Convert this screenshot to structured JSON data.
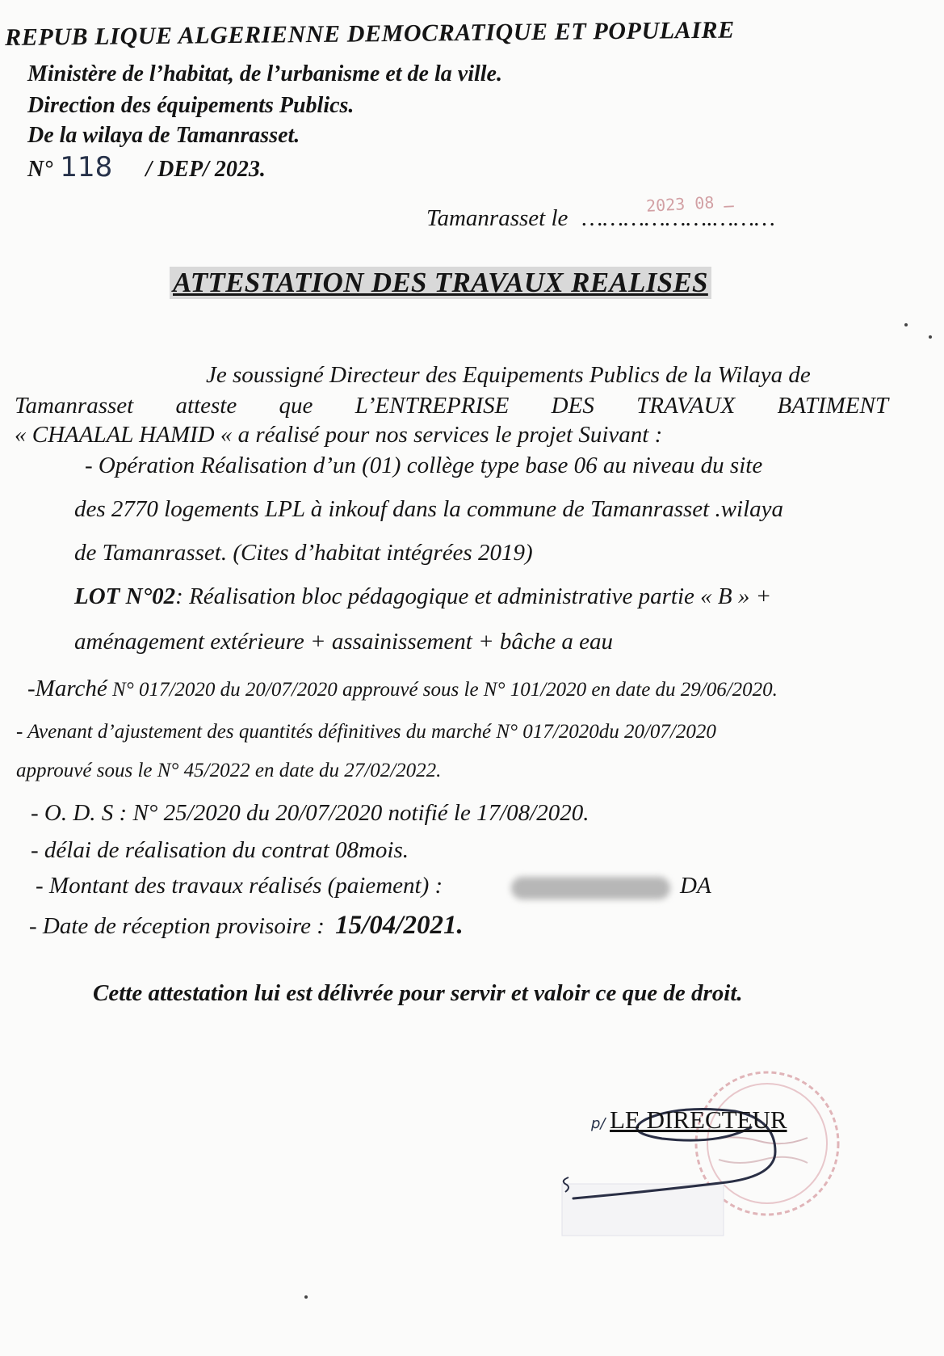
{
  "header": {
    "republic": "REPUB LIQUE  ALGERIENNE  DEMOCRATIQUE  ET  POPULAIRE",
    "ministry": "Ministère de l’habitat, de l’urbanisme et de la ville.",
    "direction": "Direction  des équipements Publics.",
    "wilaya": "De la wilaya de Tamanrasset.",
    "ref_prefix": "N°",
    "ref_number": "118",
    "ref_suffix": "/ DEP/ 2023."
  },
  "date_line": {
    "label": "Tamanrasset le",
    "dots": "……………….………",
    "stamp": "2023 ـ 08"
  },
  "title": "ATTESTATION DES TRAVAUX REALISES",
  "intro": {
    "line1": "Je soussigné Directeur  des Equipements Publics de la Wilaya de",
    "line2_words": [
      "Tamanrasset",
      "atteste",
      "que",
      "L’ENTREPRISE",
      "DES",
      "TRAVAUX",
      "BATIMENT"
    ],
    "line3": "« CHAALAL HAMID «    a réalisé pour nos services le projet Suivant :"
  },
  "operation": {
    "line1": "-   Opération Réalisation d’un (01) collège type base 06 au niveau du site",
    "line2": "des 2770 logements LPL  à inkouf dans la commune de Tamanrasset .wilaya",
    "line3": "de Tamanrasset. (Cites d’habitat intégrées 2019)"
  },
  "lot": {
    "label": "LOT N°02",
    "text1": ": Réalisation bloc pédagogique et administrative partie « B » +",
    "text2": "aménagement extérieure + assainissement + bâche a eau"
  },
  "details": {
    "marche_label": "-Marché",
    "marche_text": " N° 017/2020 du 20/07/2020 approuvé sous  le N° 101/2020  en date du 29/06/2020.",
    "avenant1": "- Avenant d’ajustement des quantités définitives du marché N° 017/2020du 20/07/2020",
    "avenant2": "approuvé sous  le N° 45/2022 en date du 27/02/2022.",
    "ods": "- O. D. S   : N°  25/2020  du 20/07/2020  notifié le 17/08/2020.",
    "delai": "-  délai de réalisation du contrat 08mois.",
    "montant_label": "- Montant des travaux réalisés (paiement) :",
    "montant_currency": "DA",
    "reception_label": "- Date de réception provisoire    :",
    "reception_date": "15/04/2021."
  },
  "closing": "Cette  attestation lui est délivrée pour servir et valoir ce que de droit.",
  "signature": {
    "prefix": "p/",
    "title": "LE DIRECTEUR"
  }
}
